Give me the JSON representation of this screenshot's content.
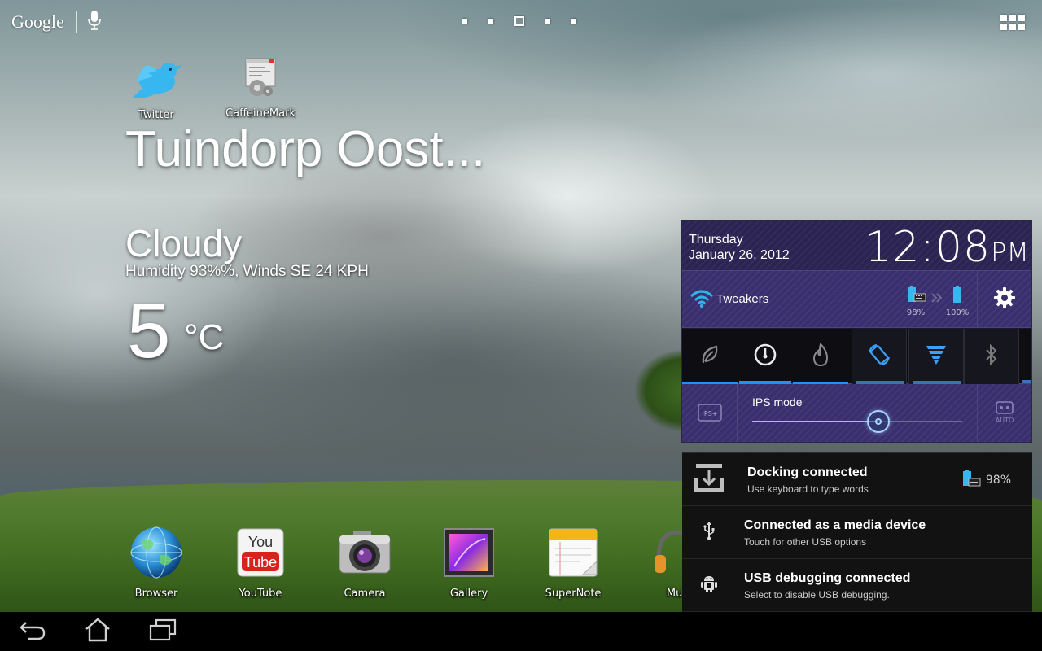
{
  "top_bar": {
    "google_label": "Google",
    "page_count": 5,
    "active_page": 3
  },
  "shortcuts": [
    {
      "label": "Twitter",
      "icon": "twitter-bird-icon"
    },
    {
      "label": "CaffeineMark",
      "icon": "caffeinemark-icon"
    }
  ],
  "weather": {
    "city": "Tuindorp Oost...",
    "condition": "Cloudy",
    "details": "Humidity 93%%, Winds SE 24 KPH",
    "temperature": "5",
    "unit": "°C"
  },
  "dock": [
    {
      "label": "Browser",
      "icon": "browser-globe-icon"
    },
    {
      "label": "YouTube",
      "icon": "youtube-icon"
    },
    {
      "label": "Camera",
      "icon": "camera-icon"
    },
    {
      "label": "Gallery",
      "icon": "gallery-icon"
    },
    {
      "label": "SuperNote",
      "icon": "supernote-icon"
    },
    {
      "label": "Mus",
      "icon": "music-headphones-icon"
    }
  ],
  "quick_settings": {
    "day": "Thursday",
    "date": "January 26, 2012",
    "time": "12:08",
    "ampm": "PM",
    "wifi_name": "Tweakers",
    "dock_battery_pct": "98%",
    "tablet_battery_pct": "100%",
    "toggles": [
      "power-saving-icon",
      "balanced-mode-icon",
      "performance-mode-icon",
      "auto-rotate-icon",
      "wifi-toggle-icon",
      "bluetooth-icon"
    ],
    "ips_label": "IPS mode",
    "ips_icon_label": "IPS+",
    "auto_label": "AUTO",
    "brightness_level": 0.6,
    "accent_color": "#1e90ff"
  },
  "notifications": [
    {
      "title": "Docking connected",
      "subtitle": "Use keyboard to type words",
      "icon": "docking-icon",
      "battery_pct": "98%"
    },
    {
      "title": "Connected as a media device",
      "subtitle": "Touch for other USB options",
      "icon": "usb-icon"
    },
    {
      "title": "USB debugging connected",
      "subtitle": "Select to disable USB debugging.",
      "icon": "android-debug-icon"
    }
  ]
}
